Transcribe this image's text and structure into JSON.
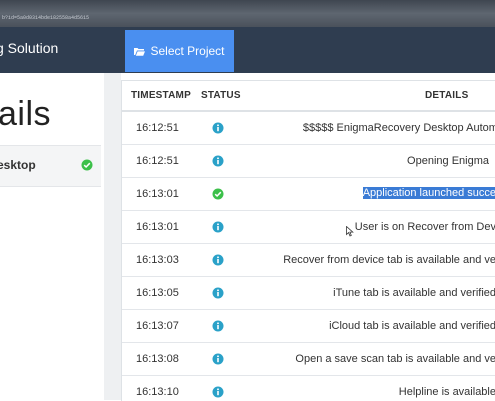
{
  "browser": {
    "url_fragment": "b?id=5a0d0314bde182558a4d5615"
  },
  "navbar": {
    "brand": "g Solution",
    "select_project_label": "Select Project"
  },
  "left": {
    "title": "ails",
    "project_item": "esktop"
  },
  "table": {
    "headers": {
      "timestamp": "TIMESTAMP",
      "status": "STATUS",
      "details": "DETAILS"
    },
    "rows": [
      {
        "timestamp": "16:12:51",
        "status": "info",
        "details": "$$$$$ EnigmaRecovery Desktop Automation @"
      },
      {
        "timestamp": "16:12:51",
        "status": "info",
        "details": "Opening Enigma"
      },
      {
        "timestamp": "16:13:01",
        "status": "success",
        "details": "Application launched succe"
      },
      {
        "timestamp": "16:13:01",
        "status": "info",
        "details": "User is on Recover from Dev"
      },
      {
        "timestamp": "16:13:03",
        "status": "info",
        "details": "Recover from device tab is available and ve"
      },
      {
        "timestamp": "16:13:05",
        "status": "info",
        "details": "iTune tab is available and verified"
      },
      {
        "timestamp": "16:13:07",
        "status": "info",
        "details": "iCloud tab is available and verified"
      },
      {
        "timestamp": "16:13:08",
        "status": "info",
        "details": "Open a save scan tab is available and ve"
      },
      {
        "timestamp": "16:13:10",
        "status": "info",
        "details": "Helpline is available"
      }
    ]
  },
  "colors": {
    "navbar": "#2f3d50",
    "accent_button": "#4a8ff0",
    "info": "#2aa1c8",
    "success": "#3cc04a",
    "selection": "#3a7bd5"
  },
  "icons": {
    "select_project": "folder-open-icon",
    "info": "info-icon",
    "success": "check-circle-icon",
    "cursor": "mouse-cursor-icon"
  }
}
